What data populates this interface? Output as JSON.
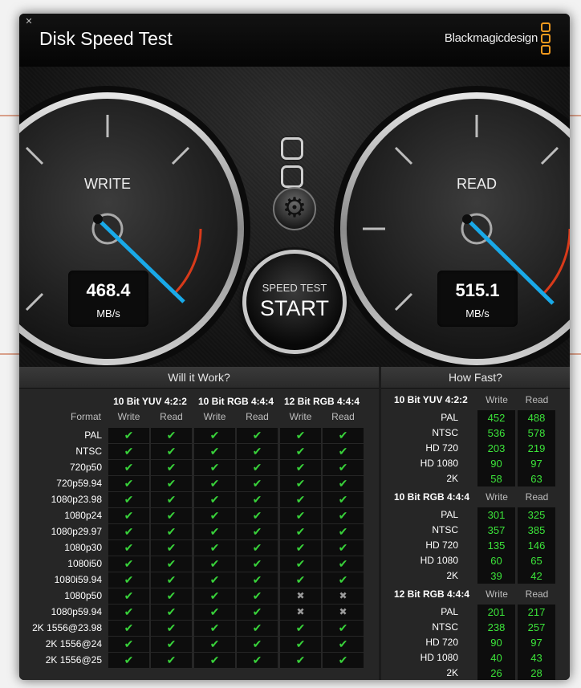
{
  "window": {
    "title": "Disk Speed Test",
    "brand": "Blackmagicdesign",
    "accent_color": "#f39a1e"
  },
  "gauges": {
    "write": {
      "label": "WRITE",
      "value": "468.4",
      "unit": "MB/s"
    },
    "read": {
      "label": "READ",
      "value": "515.1",
      "unit": "MB/s"
    }
  },
  "start_button": {
    "small": "SPEED TEST",
    "big": "START"
  },
  "will_it_work": {
    "title": "Will it Work?",
    "format_header": "Format",
    "groups": [
      "10 Bit YUV 4:2:2",
      "10 Bit RGB 4:4:4",
      "12 Bit RGB 4:4:4"
    ],
    "subheaders": [
      "Write",
      "Read"
    ],
    "rows": [
      {
        "format": "PAL",
        "results": [
          1,
          1,
          1,
          1,
          1,
          1
        ]
      },
      {
        "format": "NTSC",
        "results": [
          1,
          1,
          1,
          1,
          1,
          1
        ]
      },
      {
        "format": "720p50",
        "results": [
          1,
          1,
          1,
          1,
          1,
          1
        ]
      },
      {
        "format": "720p59.94",
        "results": [
          1,
          1,
          1,
          1,
          1,
          1
        ]
      },
      {
        "format": "1080p23.98",
        "results": [
          1,
          1,
          1,
          1,
          1,
          1
        ]
      },
      {
        "format": "1080p24",
        "results": [
          1,
          1,
          1,
          1,
          1,
          1
        ]
      },
      {
        "format": "1080p29.97",
        "results": [
          1,
          1,
          1,
          1,
          1,
          1
        ]
      },
      {
        "format": "1080p30",
        "results": [
          1,
          1,
          1,
          1,
          1,
          1
        ]
      },
      {
        "format": "1080i50",
        "results": [
          1,
          1,
          1,
          1,
          1,
          1
        ]
      },
      {
        "format": "1080i59.94",
        "results": [
          1,
          1,
          1,
          1,
          1,
          1
        ]
      },
      {
        "format": "1080p50",
        "results": [
          1,
          1,
          1,
          1,
          0,
          0
        ]
      },
      {
        "format": "1080p59.94",
        "results": [
          1,
          1,
          1,
          1,
          0,
          0
        ]
      },
      {
        "format": "2K 1556@23.98",
        "results": [
          1,
          1,
          1,
          1,
          1,
          1
        ]
      },
      {
        "format": "2K 1556@24",
        "results": [
          1,
          1,
          1,
          1,
          1,
          1
        ]
      },
      {
        "format": "2K 1556@25",
        "results": [
          1,
          1,
          1,
          1,
          1,
          1
        ]
      }
    ]
  },
  "how_fast": {
    "title": "How Fast?",
    "subheaders": [
      "Write",
      "Read"
    ],
    "groups": [
      {
        "name": "10 Bit YUV 4:2:2",
        "rows": [
          {
            "format": "PAL",
            "write": "452",
            "read": "488"
          },
          {
            "format": "NTSC",
            "write": "536",
            "read": "578"
          },
          {
            "format": "HD 720",
            "write": "203",
            "read": "219"
          },
          {
            "format": "HD 1080",
            "write": "90",
            "read": "97"
          },
          {
            "format": "2K",
            "write": "58",
            "read": "63"
          }
        ]
      },
      {
        "name": "10 Bit RGB 4:4:4",
        "rows": [
          {
            "format": "PAL",
            "write": "301",
            "read": "325"
          },
          {
            "format": "NTSC",
            "write": "357",
            "read": "385"
          },
          {
            "format": "HD 720",
            "write": "135",
            "read": "146"
          },
          {
            "format": "HD 1080",
            "write": "60",
            "read": "65"
          },
          {
            "format": "2K",
            "write": "39",
            "read": "42"
          }
        ]
      },
      {
        "name": "12 Bit RGB 4:4:4",
        "rows": [
          {
            "format": "PAL",
            "write": "201",
            "read": "217"
          },
          {
            "format": "NTSC",
            "write": "238",
            "read": "257"
          },
          {
            "format": "HD 720",
            "write": "90",
            "read": "97"
          },
          {
            "format": "HD 1080",
            "write": "40",
            "read": "43"
          },
          {
            "format": "2K",
            "write": "26",
            "read": "28"
          }
        ]
      }
    ]
  },
  "icons": {
    "close": "close-icon",
    "settings": "gear-icon",
    "check": "checkmark-icon",
    "cross": "cross-icon"
  },
  "colors": {
    "ok": "#38d23a",
    "value": "#3ce43a",
    "needle": "#19a9e8",
    "redline": "#d83a1a"
  }
}
